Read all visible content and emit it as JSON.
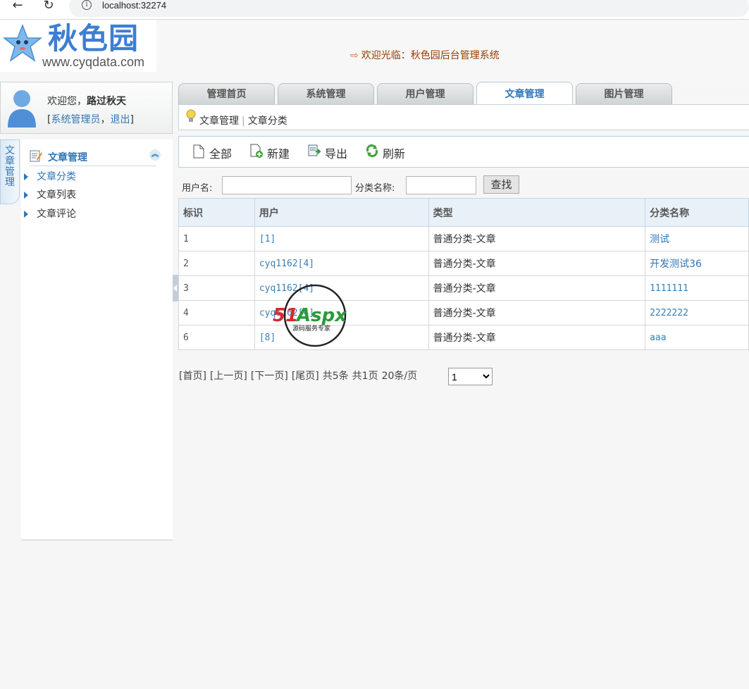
{
  "browser": {
    "url": "localhost:32274",
    "back_icon": "back-arrow-icon",
    "reload_icon": "reload-icon",
    "info_icon": "info-icon"
  },
  "header": {
    "logo_text": "秋色园",
    "logo_domain": "www.cyqdata.com",
    "welcome": "欢迎光临：秋色园后台管理系统"
  },
  "user": {
    "greeting": "欢迎您，",
    "name": "路过秋天",
    "role": "系统管理员",
    "logout": "退出"
  },
  "side_tab": "文章管理",
  "sidebar": {
    "title": "文章管理",
    "items": [
      {
        "label": "文章分类",
        "active": true
      },
      {
        "label": "文章列表",
        "active": false
      },
      {
        "label": "文章评论",
        "active": false
      }
    ]
  },
  "tabs": [
    {
      "label": "管理首页",
      "active": false
    },
    {
      "label": "系统管理",
      "active": false
    },
    {
      "label": "用户管理",
      "active": false
    },
    {
      "label": "文章管理",
      "active": true
    },
    {
      "label": "图片管理",
      "active": false
    }
  ],
  "breadcrumb": [
    "文章管理",
    "文章分类"
  ],
  "toolbar": {
    "all": "全部",
    "new": "新建",
    "export": "导出",
    "refresh": "刷新"
  },
  "search": {
    "user_label": "用户名:",
    "user_value": "",
    "category_label": "分类名称:",
    "category_value": "",
    "button": "查找"
  },
  "table": {
    "columns": [
      "标识",
      "用户",
      "类型",
      "分类名称"
    ],
    "rows": [
      {
        "id": "1",
        "user": "[1]",
        "type": "普通分类-文章",
        "name": "测试"
      },
      {
        "id": "2",
        "user": "cyq1162[4]",
        "type": "普通分类-文章",
        "name": "开发测试36"
      },
      {
        "id": "3",
        "user": "cyq1162[4]",
        "type": "普通分类-文章",
        "name": "1111111"
      },
      {
        "id": "4",
        "user": "cyq1162[4]",
        "type": "普通分类-文章",
        "name": "2222222"
      },
      {
        "id": "6",
        "user": "[8]",
        "type": "普通分类-文章",
        "name": "aaa"
      }
    ]
  },
  "pager": {
    "first": "[首页]",
    "prev": "[上一页]",
    "next": "[下一页]",
    "last": "[尾页]",
    "total": "共5条",
    "pages": "共1页",
    "per_page": "20条/页",
    "current": "1"
  },
  "watermark": {
    "brand": "51Aspx",
    "tagline": "源码服务专家"
  }
}
